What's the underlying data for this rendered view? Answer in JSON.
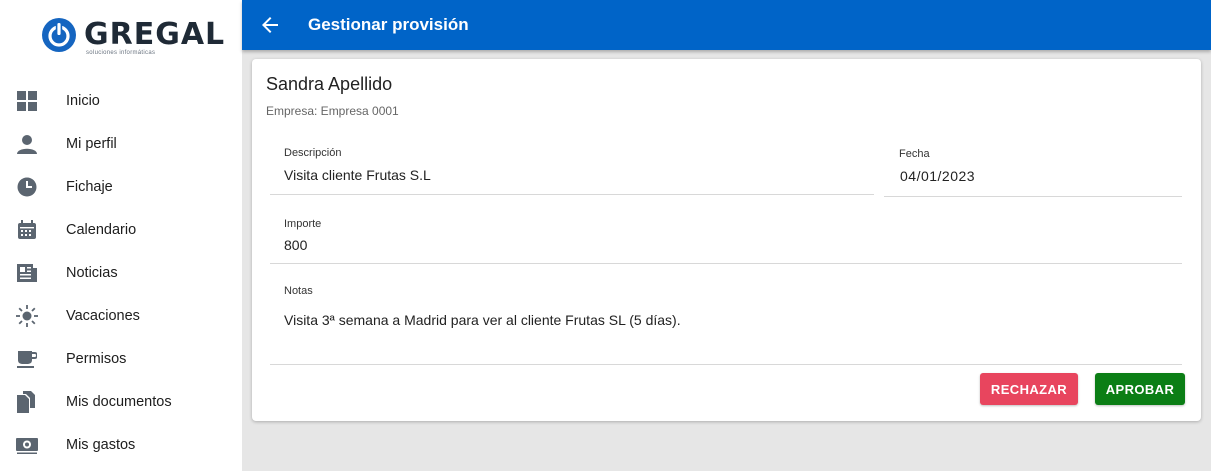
{
  "brand": {
    "name": "GREGAL",
    "tagline": "soluciones informáticas",
    "color": "#0064c8"
  },
  "sidebar": {
    "items": [
      {
        "label": "Inicio",
        "icon": "dashboard-icon"
      },
      {
        "label": "Mi perfil",
        "icon": "person-icon"
      },
      {
        "label": "Fichaje",
        "icon": "clock-icon"
      },
      {
        "label": "Calendario",
        "icon": "calendar-icon"
      },
      {
        "label": "Noticias",
        "icon": "newspaper-icon"
      },
      {
        "label": "Vacaciones",
        "icon": "sun-icon"
      },
      {
        "label": "Permisos",
        "icon": "coffee-icon"
      },
      {
        "label": "Mis documentos",
        "icon": "documents-icon"
      },
      {
        "label": "Mis gastos",
        "icon": "money-icon"
      }
    ]
  },
  "header": {
    "title": "Gestionar provisión"
  },
  "card": {
    "name": "Sandra Apellido",
    "company": "Empresa: Empresa 0001",
    "descripcion": {
      "label": "Descripción",
      "value": "Visita cliente Frutas S.L"
    },
    "fecha": {
      "label": "Fecha",
      "value": "04/01/2023"
    },
    "importe": {
      "label": "Importe",
      "value": "800"
    },
    "notas": {
      "label": "Notas",
      "value": "Visita 3ª semana a Madrid para ver al cliente Frutas SL (5 días)."
    },
    "reject_label": "RECHAZAR",
    "approve_label": "APROBAR"
  },
  "colors": {
    "header": "#0064c8",
    "reject": "#e8455e",
    "approve": "#0b7e15",
    "icon": "#5b6570"
  }
}
